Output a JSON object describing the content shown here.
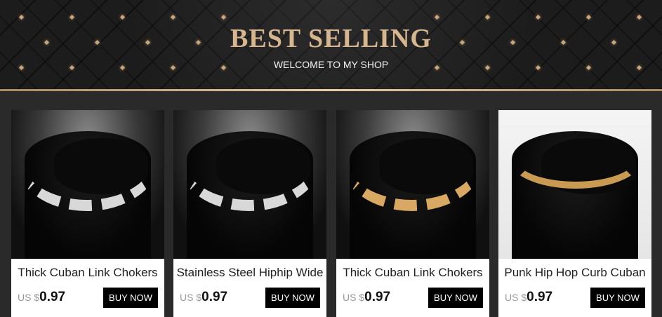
{
  "banner": {
    "title": "BEST SELLING",
    "subtitle": "WELCOME TO MY SHOP",
    "accent_color": "#d7b68f"
  },
  "products": [
    {
      "title": "Thick Cuban Link Chokers",
      "price_prefix": "US $",
      "price": "0.97",
      "buy_label": "BUY NOW",
      "image": "silver-cuban-chain-on-black-bust"
    },
    {
      "title": "Stainless Steel Hiphip Wide",
      "price_prefix": "US $",
      "price": "0.97",
      "buy_label": "BUY NOW",
      "image": "steel-wide-chain-on-black-bust"
    },
    {
      "title": "Thick Cuban Link Chokers",
      "price_prefix": "US $",
      "price": "0.97",
      "buy_label": "BUY NOW",
      "image": "gold-cuban-chain-on-black-bust"
    },
    {
      "title": "Punk Hip Hop Curb Cuban",
      "price_prefix": "US $",
      "price": "0.97",
      "buy_label": "BUY NOW",
      "image": "gold-curb-chain-on-black-bust"
    }
  ]
}
